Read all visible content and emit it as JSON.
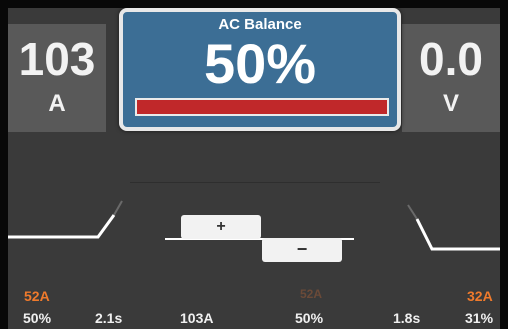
{
  "left_panel": {
    "value": "103",
    "unit": "A"
  },
  "right_panel": {
    "value": "0.0",
    "unit": "V"
  },
  "popup": {
    "title": "AC Balance",
    "value": "50%",
    "bar_level": 1.0,
    "bar_color": "#c0282a",
    "bg_color": "#3c6e95"
  },
  "controls": {
    "plus_label": "+",
    "minus_label": "−"
  },
  "bottom": {
    "left_current": "52A",
    "right_current": "32A",
    "center_current_faded": "52A",
    "values": [
      "50%",
      "2.1s",
      "103A",
      "50%",
      "1.8s",
      "31%"
    ]
  },
  "colors": {
    "accent_orange": "#ef7a2c",
    "screen_bg": "#3a3a3a",
    "panel_bg": "#595959"
  }
}
